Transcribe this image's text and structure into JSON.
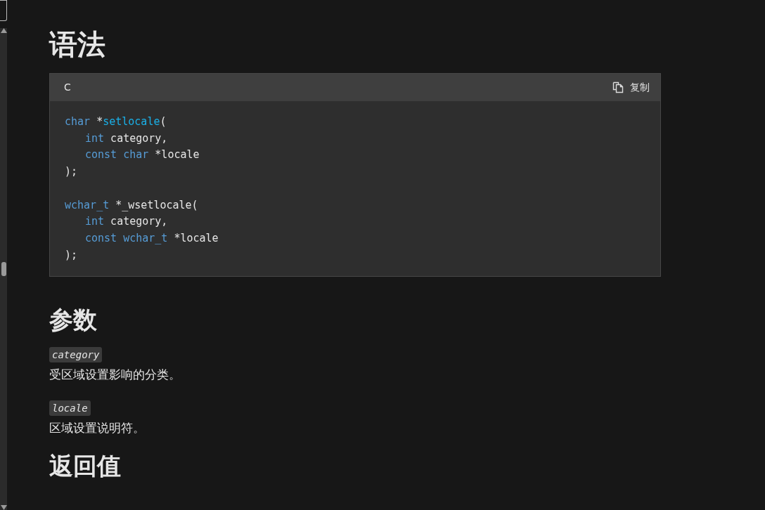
{
  "sections": [
    {
      "heading": "语法",
      "code": {
        "language": "C",
        "copy_label": "复制",
        "blocks": [
          [
            {
              "indented": false,
              "tokens": [
                {
                  "t": "char",
                  "kind": "keyword"
                },
                {
                  "t": " *",
                  "kind": "plain"
                },
                {
                  "t": "setlocale",
                  "kind": "function"
                },
                {
                  "t": "(",
                  "kind": "plain"
                }
              ]
            },
            {
              "indented": true,
              "tokens": [
                {
                  "t": "int",
                  "kind": "keyword"
                },
                {
                  "t": " category,",
                  "kind": "plain"
                }
              ]
            },
            {
              "indented": true,
              "tokens": [
                {
                  "t": "const",
                  "kind": "keyword"
                },
                {
                  "t": " char",
                  "kind": "keyword"
                },
                {
                  "t": " *locale",
                  "kind": "plain"
                }
              ]
            },
            {
              "indented": false,
              "tokens": [
                {
                  "t": ");",
                  "kind": "plain"
                }
              ]
            }
          ],
          [
            {
              "indented": false,
              "tokens": [
                {
                  "t": "wchar_t",
                  "kind": "keyword"
                },
                {
                  "t": " *_wsetlocale(",
                  "kind": "plain"
                }
              ]
            },
            {
              "indented": true,
              "tokens": [
                {
                  "t": "int",
                  "kind": "keyword"
                },
                {
                  "t": " category,",
                  "kind": "plain"
                }
              ]
            },
            {
              "indented": true,
              "tokens": [
                {
                  "t": "const",
                  "kind": "keyword"
                },
                {
                  "t": " wchar_t",
                  "kind": "keyword"
                },
                {
                  "t": " *locale",
                  "kind": "plain"
                }
              ]
            },
            {
              "indented": false,
              "tokens": [
                {
                  "t": ");",
                  "kind": "plain"
                }
              ]
            }
          ]
        ]
      }
    },
    {
      "heading": "参数",
      "params": [
        {
          "name": "category",
          "description": "受区域设置影响的分类。"
        },
        {
          "name": "locale",
          "description": "区域设置说明符。"
        }
      ]
    },
    {
      "heading": "返回值"
    }
  ]
}
